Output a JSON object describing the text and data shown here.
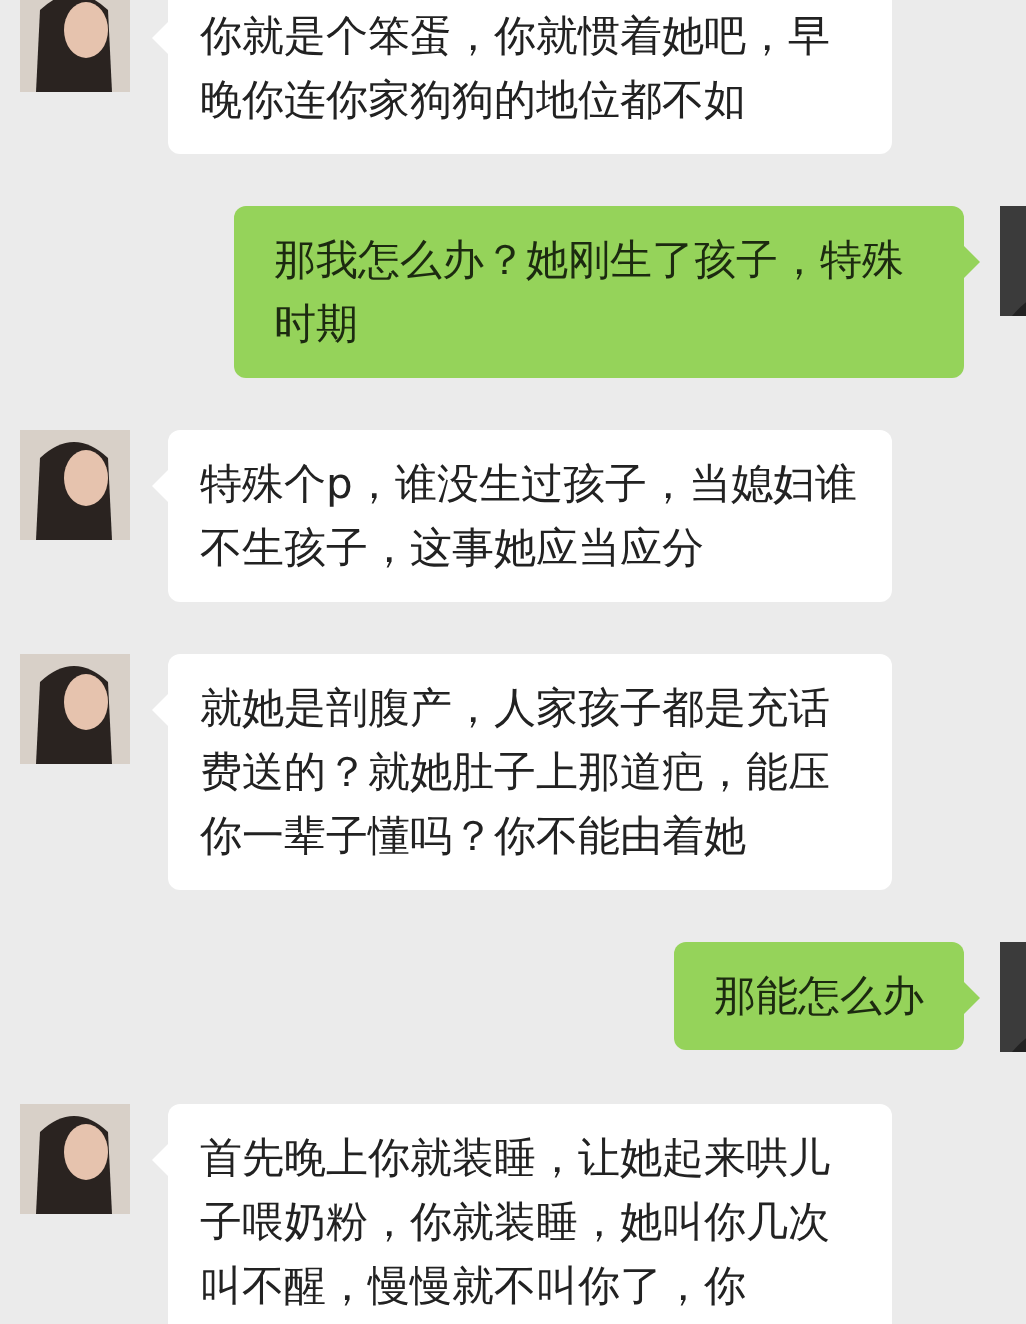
{
  "messages": [
    {
      "kind": "received",
      "text": "你就是个笨蛋，你就惯着她吧，早晚你连你家狗狗的地位都不如"
    },
    {
      "kind": "sent",
      "text": "那我怎么办？她刚生了孩子，特殊时期"
    },
    {
      "kind": "received",
      "text": "特殊个p，谁没生过孩子，当媳妇谁不生孩子，这事她应当应分"
    },
    {
      "kind": "received",
      "text": "就她是剖腹产，人家孩子都是充话费送的？就她肚子上那道疤，能压你一辈子懂吗？你不能由着她"
    },
    {
      "kind": "sent",
      "text": "那能怎么办"
    },
    {
      "kind": "received",
      "text": "首先晚上你就装睡，让她起来哄儿子喂奶粉，你就装睡，她叫你几次叫不醒，慢慢就不叫你了，你"
    }
  ]
}
